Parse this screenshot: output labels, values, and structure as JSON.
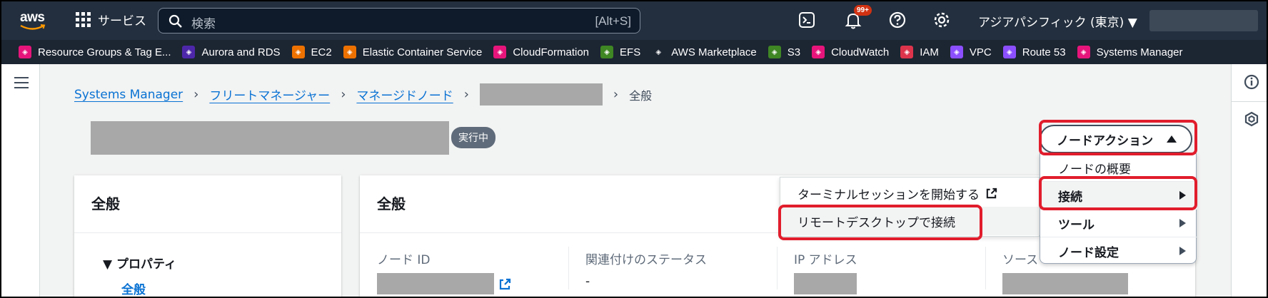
{
  "topnav": {
    "logo": "aws",
    "services_label": "サービス",
    "search": {
      "placeholder": "検索",
      "shortcut": "[Alt+S]"
    },
    "notifications_badge": "99+",
    "region": "アジアパシフィック (東京) ▼"
  },
  "favorites": [
    {
      "label": "Resource Groups & Tag E...",
      "color": "#e7157b",
      "icon": "resource-groups-icon"
    },
    {
      "label": "Aurora and RDS",
      "color": "#4d27aa",
      "icon": "rds-icon"
    },
    {
      "label": "EC2",
      "color": "#ed7100",
      "icon": "ec2-icon"
    },
    {
      "label": "Elastic Container Service",
      "color": "#ed7100",
      "icon": "ecs-icon"
    },
    {
      "label": "CloudFormation",
      "color": "#e7157b",
      "icon": "cloudformation-icon"
    },
    {
      "label": "EFS",
      "color": "#3f8624",
      "icon": "efs-icon"
    },
    {
      "label": "AWS Marketplace",
      "color": "#1c2532",
      "icon": "marketplace-icon"
    },
    {
      "label": "S3",
      "color": "#3f8624",
      "icon": "s3-icon"
    },
    {
      "label": "CloudWatch",
      "color": "#e7157b",
      "icon": "cloudwatch-icon"
    },
    {
      "label": "IAM",
      "color": "#dd344c",
      "icon": "iam-icon"
    },
    {
      "label": "VPC",
      "color": "#8c4fff",
      "icon": "vpc-icon"
    },
    {
      "label": "Route 53",
      "color": "#8c4fff",
      "icon": "route53-icon"
    },
    {
      "label": "Systems Manager",
      "color": "#e7157b",
      "icon": "systems-manager-icon"
    }
  ],
  "breadcrumb": {
    "items": [
      "Systems Manager",
      "フリートマネージャー",
      "マネージドノード"
    ],
    "current": "全般"
  },
  "status_badge": "実行中",
  "left_panel": {
    "heading": "全般",
    "section": "▼ プロパティ",
    "link": "全般"
  },
  "main_panel": {
    "heading": "全般",
    "fields": {
      "node_id": "ノード ID",
      "association_status": "関連付けのステータス",
      "association_value": "-",
      "ip_address": "IP アドレス",
      "source": "ソース"
    }
  },
  "node_actions": {
    "button_label": "ノードアクション",
    "items": [
      "ノードの概要",
      "接続",
      "ツール",
      "ノード設定"
    ],
    "connect_submenu": [
      "ターミナルセッションを開始する",
      "リモートデスクトップで接続"
    ]
  },
  "colors": {
    "highlight": "#e11d2c",
    "link": "#0972d3",
    "nav": "#232f3e"
  }
}
